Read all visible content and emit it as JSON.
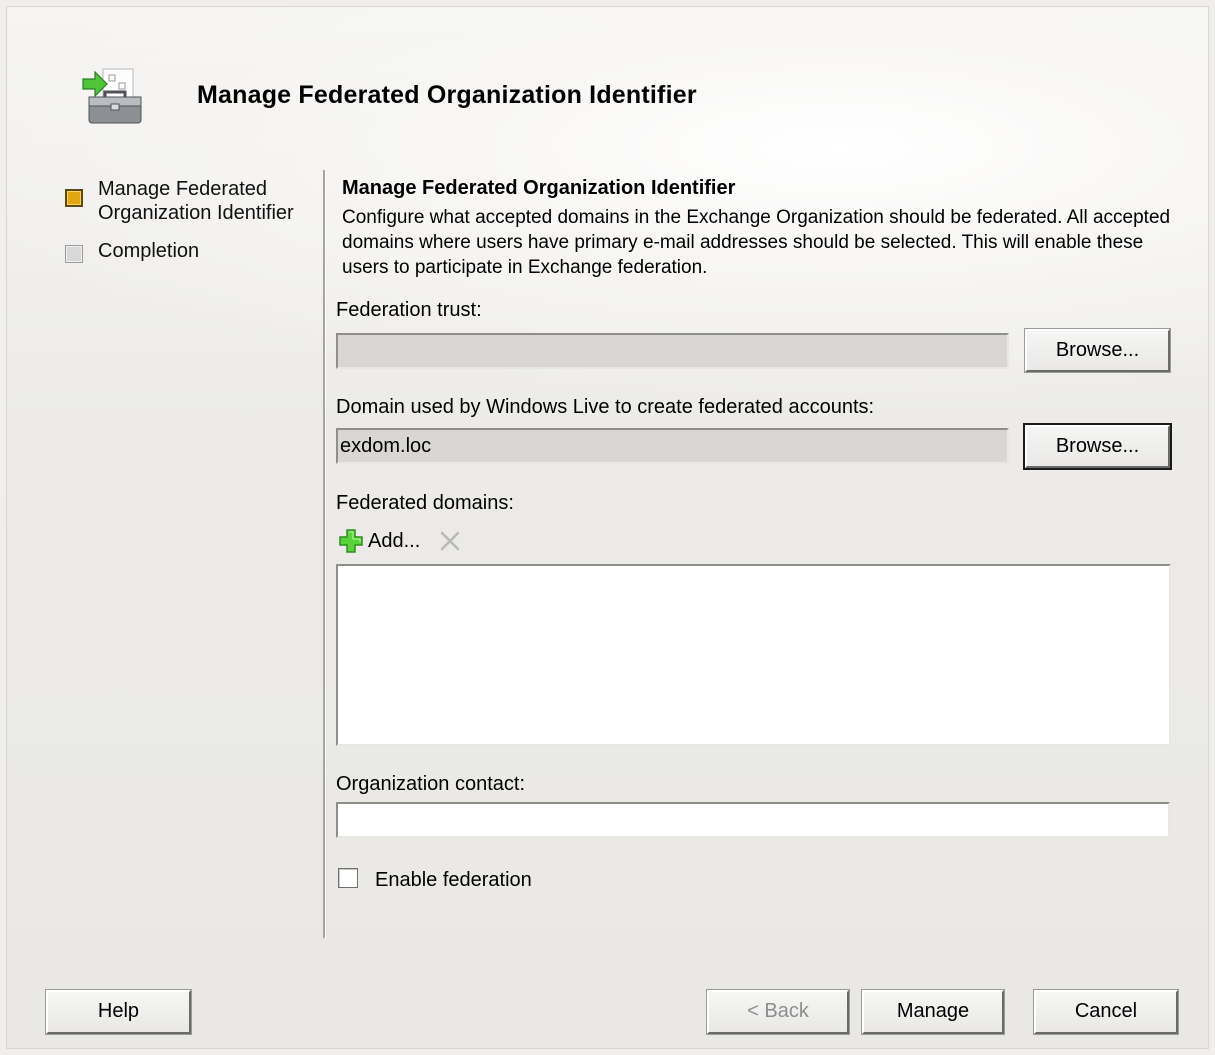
{
  "window": {
    "title": "Manage Federated Organization Identifier",
    "icon": "toolbox-with-arrow-icon"
  },
  "nav": {
    "items": [
      {
        "label": "Manage Federated Organization Identifier",
        "state": "active"
      },
      {
        "label": "Completion",
        "state": "inactive"
      }
    ]
  },
  "main": {
    "section_title": "Manage Federated Organization Identifier",
    "description": "Configure what accepted domains in the Exchange Organization should be federated. All accepted domains where users have primary e-mail addresses should be selected. This will enable these users to participate in Exchange federation.",
    "federation_trust": {
      "label": "Federation trust:",
      "value": "",
      "browse_label": "Browse..."
    },
    "windows_live_domain": {
      "label": "Domain used by Windows Live to create federated accounts:",
      "value": "exdom.loc",
      "browse_label": "Browse..."
    },
    "federated_domains": {
      "label": "Federated domains:",
      "add_label": "Add...",
      "items": []
    },
    "organization_contact": {
      "label": "Organization contact:",
      "value": ""
    },
    "enable_federation": {
      "label": "Enable federation",
      "checked": false
    }
  },
  "footer": {
    "help_label": "Help",
    "back_label": "< Back",
    "manage_label": "Manage",
    "cancel_label": "Cancel"
  },
  "colors": {
    "active_step": "#e2a60e",
    "add_icon": "#3fbf1f",
    "remove_icon_disabled": "#b9b9b9"
  }
}
